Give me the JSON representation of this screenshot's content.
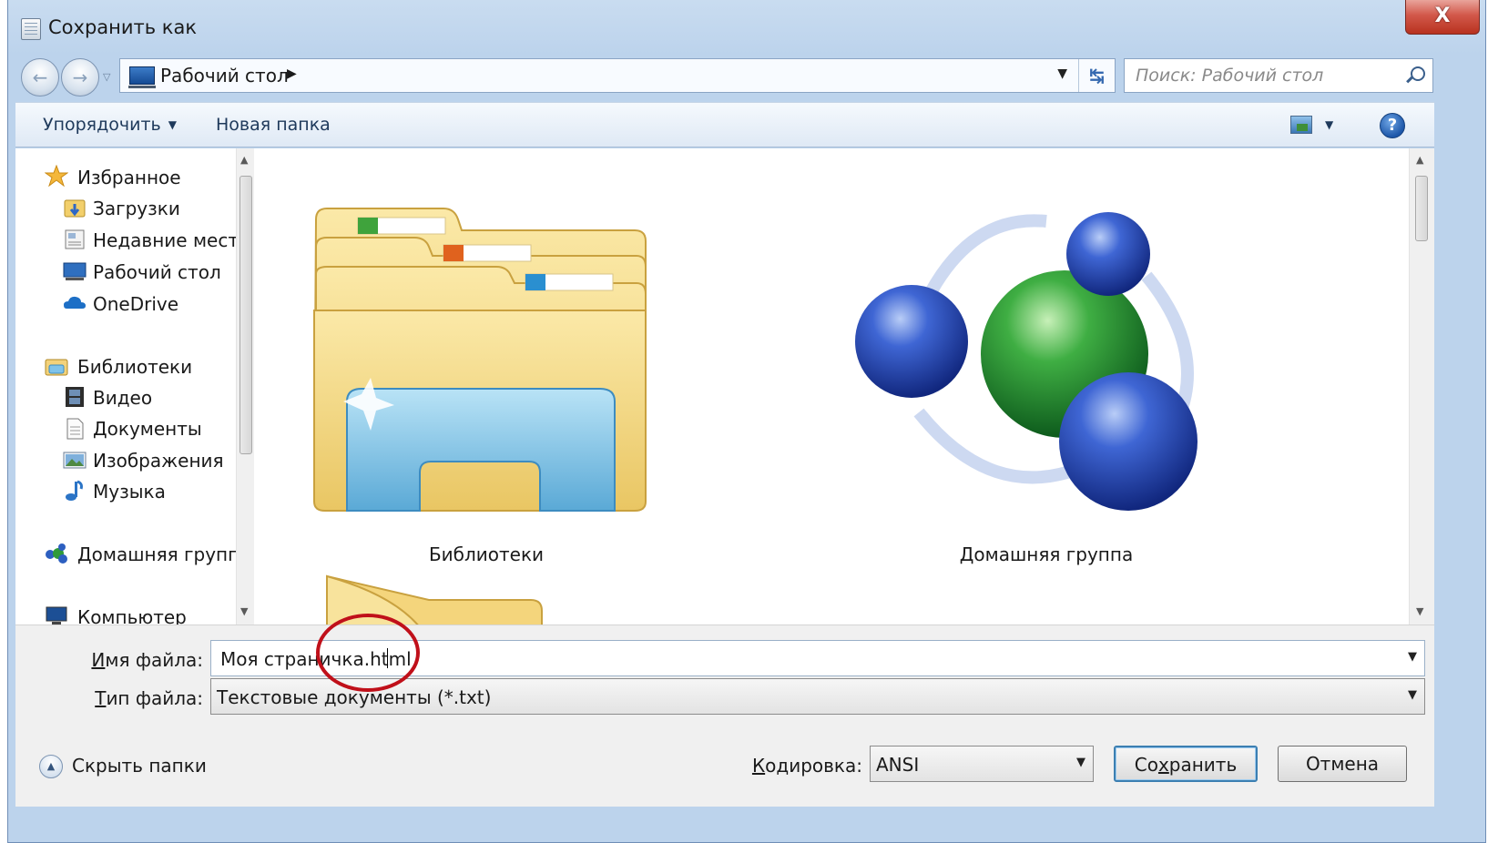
{
  "window": {
    "title": "Сохранить как",
    "close_label": "X"
  },
  "address": {
    "location": "Рабочий стол",
    "search_placeholder": "Поиск: Рабочий стол"
  },
  "toolbar": {
    "organize_label": "Упорядочить",
    "new_folder_label": "Новая папка",
    "help_label": "?"
  },
  "nav": {
    "favorites": "Избранное",
    "favorites_items": [
      "Загрузки",
      "Недавние места",
      "Рабочий стол",
      "OneDrive"
    ],
    "libraries": "Библиотеки",
    "libraries_items": [
      "Видео",
      "Документы",
      "Изображения",
      "Музыка"
    ],
    "homegroup": "Домашняя группа",
    "computer": "Компьютер"
  },
  "content": {
    "items": [
      {
        "label": "Библиотеки",
        "icon": "libraries-folder-icon"
      },
      {
        "label": "Домашняя группа",
        "icon": "homegroup-icon"
      }
    ]
  },
  "form": {
    "filename_label": "Имя файла:",
    "filename_value": "Моя страничка.html",
    "filetype_label": "Тип файла:",
    "filetype_value": "Текстовые документы (*.txt)",
    "encoding_label": "Кодировка:",
    "encoding_value": "ANSI",
    "save_label": "Сохранить",
    "cancel_label": "Отмена",
    "hide_folders_label": "Скрыть папки"
  },
  "colors": {
    "frame": "#bcd3ec",
    "close_button": "#c8442f",
    "annotation_circle": "#c0101a"
  }
}
